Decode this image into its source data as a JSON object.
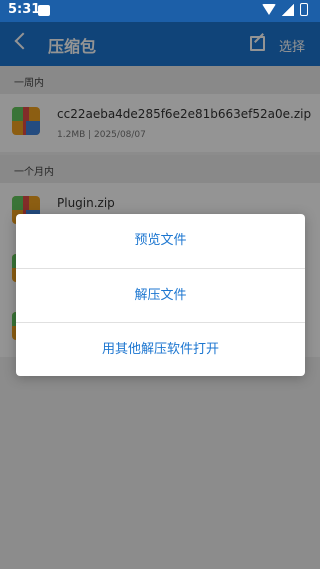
{
  "status": {
    "time": "5:31"
  },
  "appbar": {
    "title": "压缩包",
    "select_label": "选择"
  },
  "sections": [
    {
      "label": "一周内"
    },
    {
      "label": "一个月内"
    }
  ],
  "files": [
    {
      "name": "cc22aeba4de285f6e2e81b663ef52a0e.zip",
      "meta": "1.2MB | 2025/08/07"
    },
    {
      "name": "Plugin.zip"
    }
  ],
  "dialog": {
    "options": [
      "预览文件",
      "解压文件",
      "用其他解压软件打开"
    ]
  }
}
